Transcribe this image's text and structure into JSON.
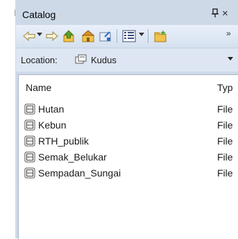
{
  "window": {
    "title": "Catalog",
    "pin_glyph": "1",
    "close_glyph": "×"
  },
  "toolbar": {
    "buttons": [
      "back-arrow-icon",
      "dropdown-arrow-icon",
      "forward-arrow-icon",
      "up-one-level-icon",
      "home-folder-icon",
      "connect-folder-icon",
      "view-grid-icon",
      "view-dropdown-icon",
      "new-folder-icon"
    ],
    "overflow_glyph": "»"
  },
  "location": {
    "label": "Location:",
    "value": "Kudus"
  },
  "list": {
    "columns": {
      "name": "Name",
      "type": "Typ"
    },
    "items": [
      {
        "name": "Hutan",
        "type": "File"
      },
      {
        "name": "Kebun",
        "type": "File"
      },
      {
        "name": "RTH_publik",
        "type": "File"
      },
      {
        "name": "Semak_Belukar",
        "type": "File"
      },
      {
        "name": "Sempadan_Sungai",
        "type": "File"
      }
    ]
  },
  "colors": {
    "panel": "#ced9e8",
    "toolbar": "#dde7f4",
    "arrow_blue": "#2e6fc9",
    "arrow_green": "#5aa12c",
    "folder_yellow": "#e8b83a"
  }
}
